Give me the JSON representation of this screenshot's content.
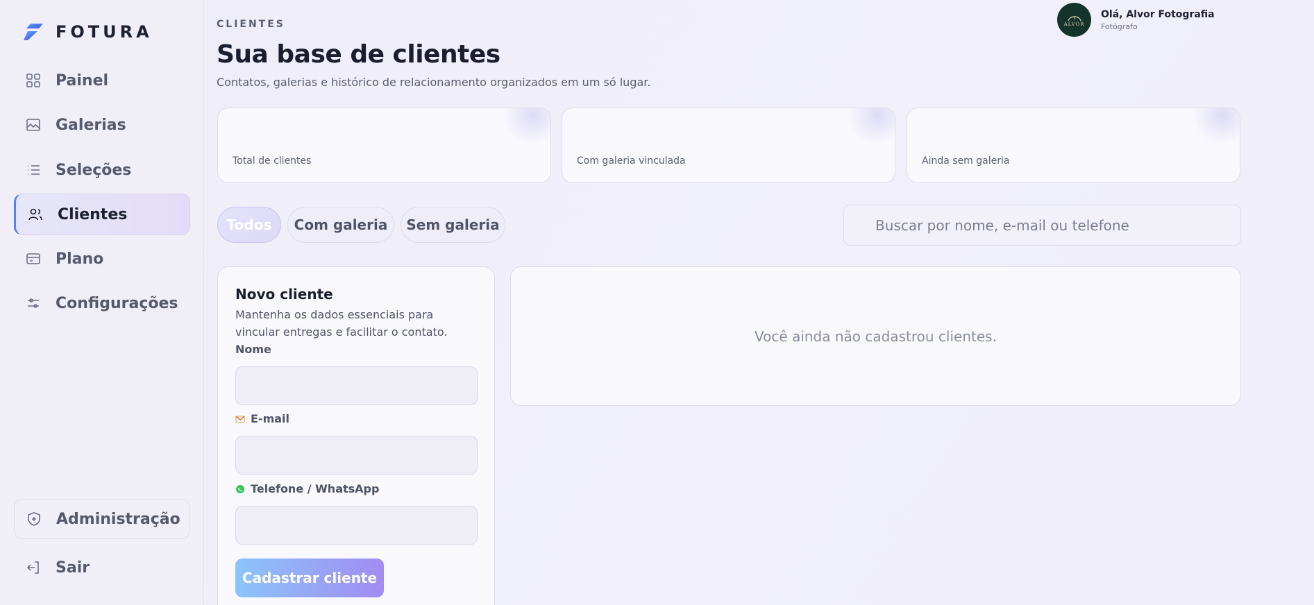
{
  "brand": {
    "name": "FOTURA"
  },
  "sidebar": {
    "items": [
      {
        "label": "Painel",
        "icon": "grid-icon"
      },
      {
        "label": "Galerias",
        "icon": "image-icon"
      },
      {
        "label": "Seleções",
        "icon": "list-icon"
      },
      {
        "label": "Clientes",
        "icon": "users-icon",
        "active": true
      },
      {
        "label": "Plano",
        "icon": "card-icon"
      },
      {
        "label": "Configurações",
        "icon": "sliders-icon"
      }
    ],
    "admin": {
      "label": "Administração",
      "icon": "shield-icon"
    },
    "logout": {
      "label": "Sair",
      "icon": "logout-icon"
    }
  },
  "header": {
    "kicker": "CLIENTES",
    "title": "Sua base de clientes",
    "subtitle": "Contatos, galerias e histórico de relacionamento organizados em um só lugar."
  },
  "user": {
    "greeting": "Olá, Alvor Fotografia",
    "role": "Fotógrafo",
    "avatar_text": "ALVOR"
  },
  "stats": [
    {
      "label": "Total de clientes"
    },
    {
      "label": "Com galeria vinculada"
    },
    {
      "label": "Ainda sem galeria"
    }
  ],
  "filters": [
    {
      "label": "Todos",
      "active": true
    },
    {
      "label": "Com galeria"
    },
    {
      "label": "Sem galeria"
    }
  ],
  "search": {
    "placeholder": "Buscar por nome, e-mail ou telefone"
  },
  "form": {
    "title": "Novo cliente",
    "description": "Mantenha os dados essenciais para vincular entregas e facilitar o contato.",
    "name_label": "Nome",
    "email_label": "E-mail",
    "phone_label": "Telefone / WhatsApp",
    "submit_label": "Cadastrar cliente"
  },
  "empty_state": {
    "message": "Você ainda não cadastrou clientes."
  },
  "colors": {
    "accent": "#5b7cf5",
    "button_start": "#8cc4fb",
    "button_end": "#a28cf2"
  }
}
